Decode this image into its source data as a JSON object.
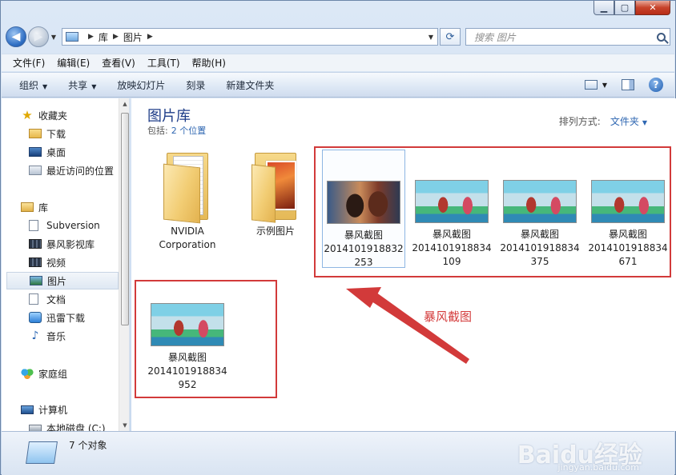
{
  "address": {
    "crumbs": [
      "库",
      "图片"
    ],
    "search_placeholder": "搜索 图片"
  },
  "menu": [
    "文件(F)",
    "编辑(E)",
    "查看(V)",
    "工具(T)",
    "帮助(H)"
  ],
  "commands": {
    "organize": "组织",
    "share": "共享",
    "slideshow": "放映幻灯片",
    "burn": "刻录",
    "new_folder": "新建文件夹"
  },
  "nav": {
    "favorites": "收藏夹",
    "downloads": "下载",
    "desktop": "桌面",
    "recent": "最近访问的位置",
    "libraries": "库",
    "subversion": "Subversion",
    "baofeng_video": "暴风影视库",
    "videos": "视频",
    "pictures": "图片",
    "documents": "文档",
    "xunlei": "迅雷下载",
    "music": "音乐",
    "homegroup": "家庭组",
    "computer": "计算机",
    "local_disk": "本地磁盘 (C:)"
  },
  "content": {
    "title": "图片库",
    "includes_label": "包括:",
    "includes_link": "2 个位置",
    "arrange_label": "排列方式:",
    "arrange_value": "文件夹",
    "items": [
      {
        "line1": "NVIDIA",
        "line2": "Corporation",
        "line3": ""
      },
      {
        "line1": "示例图片",
        "line2": "",
        "line3": ""
      },
      {
        "line1": "暴风截图",
        "line2": "2014101918832",
        "line3": "253"
      },
      {
        "line1": "暴风截图",
        "line2": "2014101918834",
        "line3": "109"
      },
      {
        "line1": "暴风截图",
        "line2": "2014101918834",
        "line3": "375"
      },
      {
        "line1": "暴风截图",
        "line2": "2014101918834",
        "line3": "671"
      },
      {
        "line1": "暴风截图",
        "line2": "2014101918834",
        "line3": "952"
      }
    ],
    "annotation": "暴风截图"
  },
  "status": {
    "count": "7 个对象",
    "watermark": "Baidu经验",
    "watermark_url": "jingyan.baidu.com"
  },
  "colors": {
    "annotation_red": "#d23a3a",
    "link_blue": "#2f67b2",
    "title_blue": "#1e3d88"
  }
}
